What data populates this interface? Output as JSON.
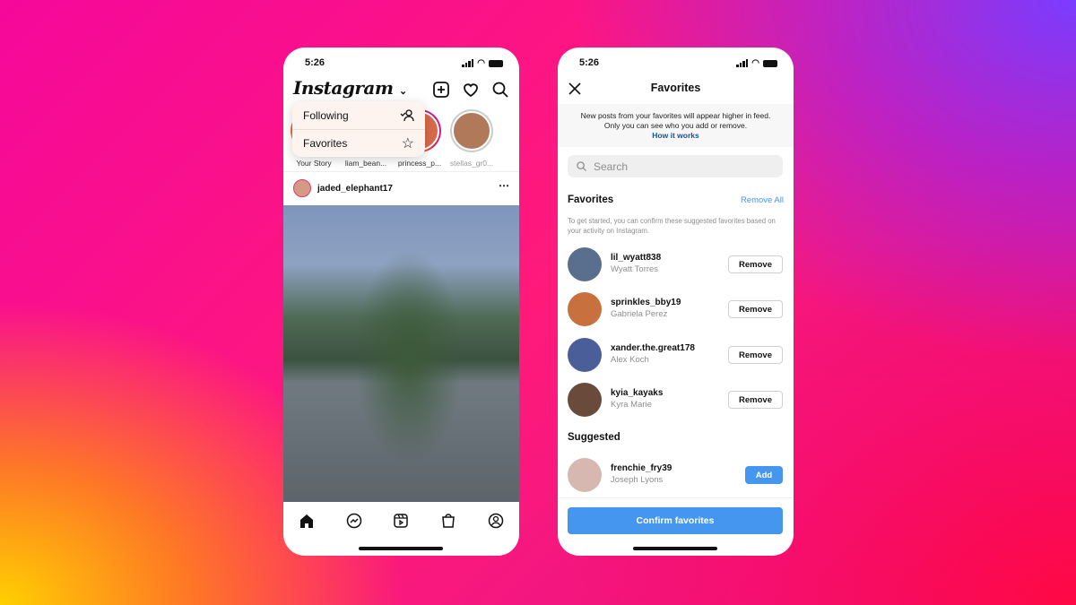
{
  "status_time": "5:26",
  "feed": {
    "logo": "Instagram",
    "menu": [
      {
        "label": "Following",
        "icon": "following-icon"
      },
      {
        "label": "Favorites",
        "icon": "star-icon"
      }
    ],
    "stories": [
      {
        "label": "Your Story",
        "color": "#d9a78a"
      },
      {
        "label": "liam_bean...",
        "color": "#c98a6a"
      },
      {
        "label": "princess_p...",
        "color": "#d86a4a"
      },
      {
        "label": "stellas_gr0...",
        "color": "#b07a5a"
      }
    ],
    "post_user": "jaded_elephant17",
    "tabs": [
      "home-icon",
      "messenger-icon",
      "reels-icon",
      "shop-icon",
      "profile-icon"
    ]
  },
  "favorites": {
    "title": "Favorites",
    "info_line1": "New posts from your favorites will appear higher in feed.",
    "info_line2": "Only you can see who you add or remove.",
    "how_it_works": "How it works",
    "search_placeholder": "Search",
    "section_title": "Favorites",
    "remove_all": "Remove All",
    "description": "To get started, you can confirm these suggested favorites based on your activity on Instagram.",
    "list": [
      {
        "username": "lil_wyatt838",
        "name": "Wyatt Torres",
        "action": "Remove",
        "color": "#5a6f8e"
      },
      {
        "username": "sprinkles_bby19",
        "name": "Gabriela Perez",
        "action": "Remove",
        "color": "#c9703f"
      },
      {
        "username": "xander.the.great178",
        "name": "Alex Koch",
        "action": "Remove",
        "color": "#4a5f9a"
      },
      {
        "username": "kyia_kayaks",
        "name": "Kyra Marie",
        "action": "Remove",
        "color": "#6a4a3a"
      }
    ],
    "suggested_title": "Suggested",
    "suggested": [
      {
        "username": "frenchie_fry39",
        "name": "Joseph Lyons",
        "action": "Add",
        "color": "#d7b8b0"
      }
    ],
    "confirm": "Confirm favorites"
  },
  "colors": {
    "accent": "#4596ee",
    "link": "#1b4f8e"
  }
}
